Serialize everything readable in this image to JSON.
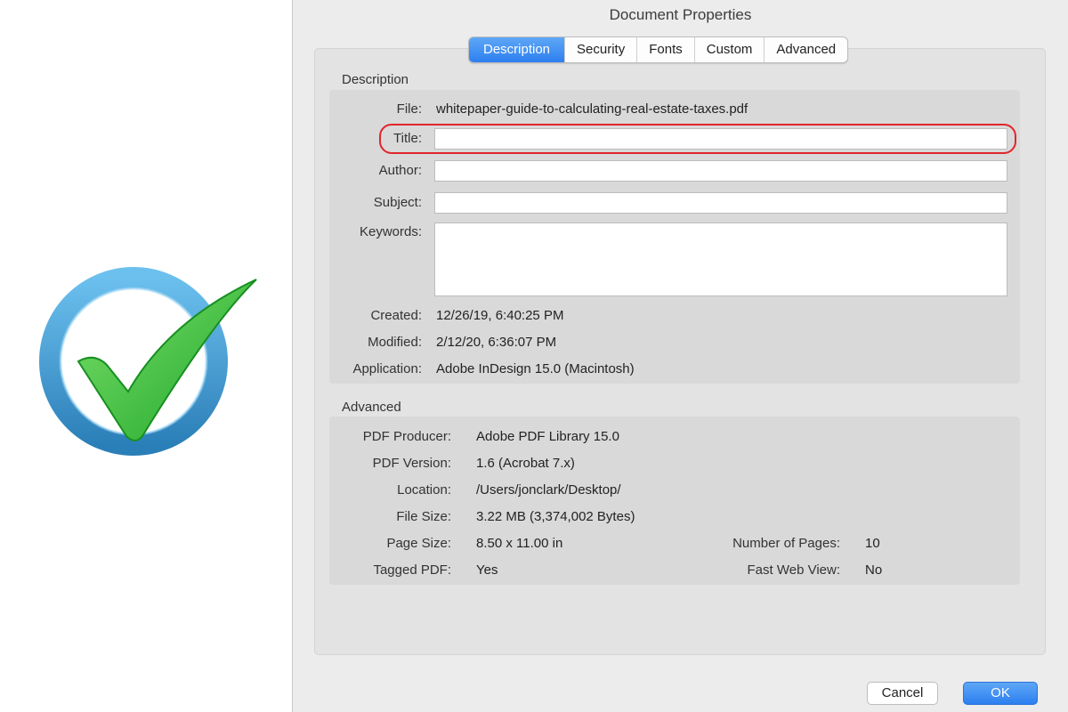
{
  "window": {
    "title": "Document Properties"
  },
  "tabs": [
    {
      "label": "Description",
      "active": true
    },
    {
      "label": "Security"
    },
    {
      "label": "Fonts"
    },
    {
      "label": "Custom"
    },
    {
      "label": "Advanced"
    }
  ],
  "description": {
    "section_label": "Description",
    "file_label": "File:",
    "file_value": "whitepaper-guide-to-calculating-real-estate-taxes.pdf",
    "title_label": "Title:",
    "title_value": "",
    "author_label": "Author:",
    "author_value": "",
    "subject_label": "Subject:",
    "subject_value": "",
    "keywords_label": "Keywords:",
    "keywords_value": "",
    "created_label": "Created:",
    "created_value": "12/26/19, 6:40:25 PM",
    "modified_label": "Modified:",
    "modified_value": "2/12/20, 6:36:07 PM",
    "application_label": "Application:",
    "application_value": "Adobe InDesign 15.0 (Macintosh)"
  },
  "advanced": {
    "section_label": "Advanced",
    "pdf_producer_label": "PDF Producer:",
    "pdf_producer_value": "Adobe PDF Library 15.0",
    "pdf_version_label": "PDF Version:",
    "pdf_version_value": "1.6 (Acrobat 7.x)",
    "location_label": "Location:",
    "location_value": "/Users/jonclark/Desktop/",
    "file_size_label": "File Size:",
    "file_size_value": "3.22 MB (3,374,002 Bytes)",
    "page_size_label": "Page Size:",
    "page_size_value": "8.50 x 11.00 in",
    "tagged_pdf_label": "Tagged PDF:",
    "tagged_pdf_value": "Yes",
    "num_pages_label": "Number of Pages:",
    "num_pages_value": "10",
    "fast_web_view_label": "Fast Web View:",
    "fast_web_view_value": "No"
  },
  "buttons": {
    "cancel": "Cancel",
    "ok": "OK"
  },
  "colors": {
    "accent": "#2d7ff0",
    "highlight": "#e0262b",
    "check_green": "#3fc43a",
    "ring_blue": "#3a9ad6"
  },
  "icons": {
    "decoration": "checkmark-circle-icon"
  }
}
